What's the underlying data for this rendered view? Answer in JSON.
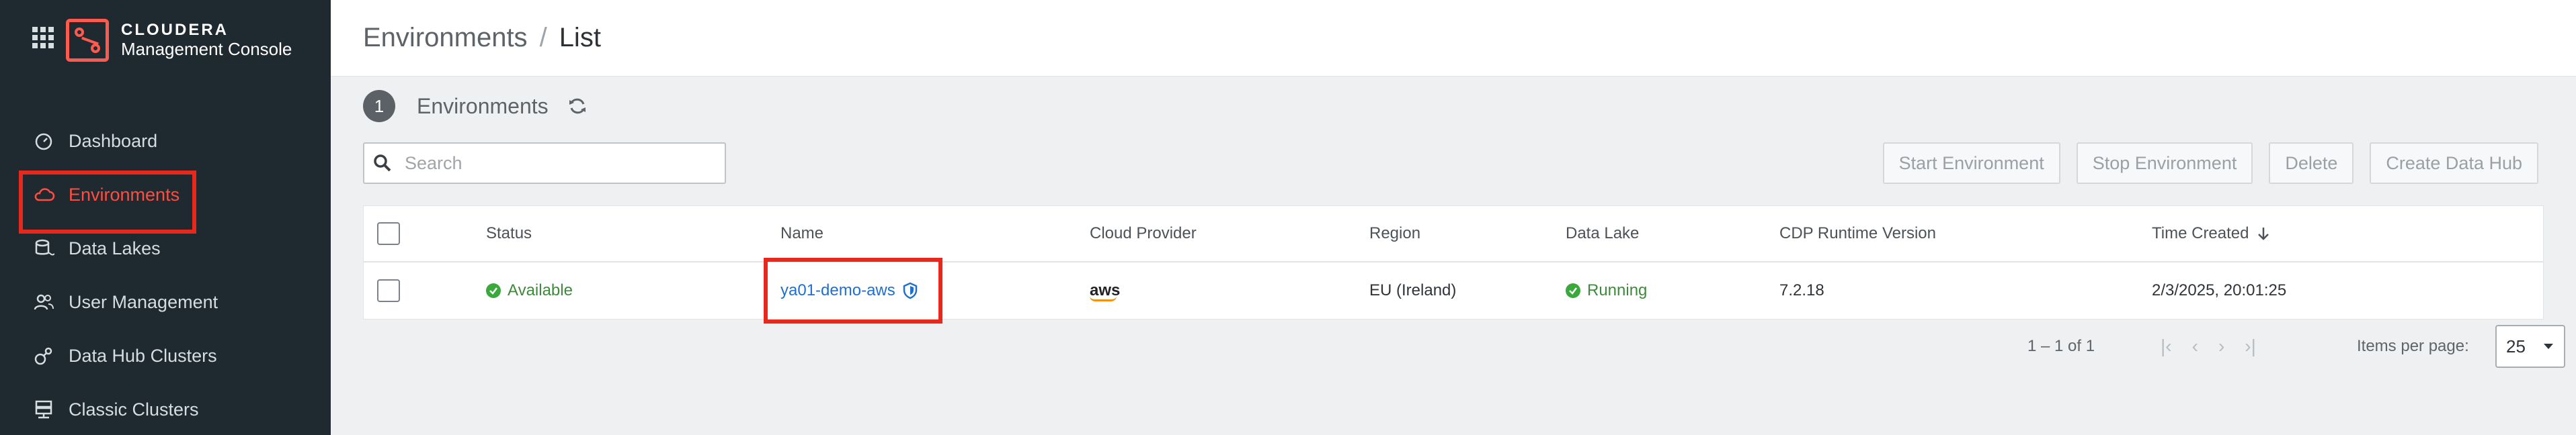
{
  "app": {
    "brand_top": "CLOUDERA",
    "brand_bottom": "Management Console"
  },
  "sidebar": {
    "items": [
      {
        "label": "Dashboard",
        "icon": "gauge-icon",
        "active": false
      },
      {
        "label": "Environments",
        "icon": "cloud-icon",
        "active": true
      },
      {
        "label": "Data Lakes",
        "icon": "data-lake-icon",
        "active": false
      },
      {
        "label": "User Management",
        "icon": "users-icon",
        "active": false
      },
      {
        "label": "Data Hub Clusters",
        "icon": "cluster-icon",
        "active": false
      },
      {
        "label": "Classic Clusters",
        "icon": "server-icon",
        "active": false
      }
    ]
  },
  "breadcrumb": {
    "section": "Environments",
    "separator": "/",
    "current": "List"
  },
  "list": {
    "count": "1",
    "title": "Environments"
  },
  "search": {
    "placeholder": "Search",
    "value": ""
  },
  "actions": {
    "start": "Start Environment",
    "stop": "Stop Environment",
    "delete": "Delete",
    "create": "Create Data Hub"
  },
  "table": {
    "columns": [
      "Status",
      "Name",
      "Cloud Provider",
      "Region",
      "Data Lake",
      "CDP Runtime Version",
      "Time Created"
    ],
    "rows": [
      {
        "status": "Available",
        "name": "ya01-demo-aws",
        "cloud_provider": "aws",
        "region": "EU (Ireland)",
        "data_lake": "Running",
        "runtime": "7.2.18",
        "time_created": "2/3/2025, 20:01:25"
      }
    ]
  },
  "pagination": {
    "range": "1 – 1 of 1",
    "items_per_page_label": "Items per page:",
    "items_per_page": "25"
  },
  "colors": {
    "accent": "#e8281c",
    "link": "#1f6fd0",
    "success": "#3aa83a",
    "sidebar_bg": "#1f2a30"
  }
}
